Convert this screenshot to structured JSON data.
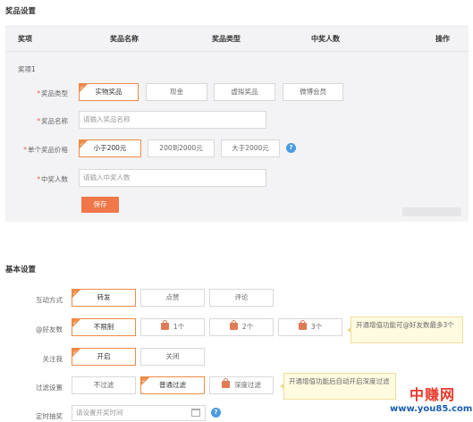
{
  "prize_settings": {
    "title": "奖品设置",
    "table_headers": [
      "奖项",
      "奖品名称",
      "奖品类型",
      "中奖人数",
      "操作"
    ],
    "prize_group_label": "奖项1",
    "prize_type": {
      "label": "奖品类型",
      "options": [
        "实物奖品",
        "现金",
        "虚拟奖品",
        "微博会员"
      ],
      "selected": "实物奖品"
    },
    "prize_name": {
      "label": "奖品名称",
      "placeholder": "请输入奖品名称"
    },
    "unit_price": {
      "label": "单个奖品价格",
      "options": [
        "小于200元",
        "200到2000元",
        "大于2000元"
      ],
      "selected": "小于200元",
      "help": "?"
    },
    "winner_count": {
      "label": "中奖人数",
      "placeholder": "请输入中奖人数"
    },
    "save_label": "保存"
  },
  "basic_settings": {
    "title": "基本设置",
    "interaction": {
      "label": "互动方式",
      "options": [
        "转发",
        "点赞",
        "评论"
      ],
      "selected": "转发"
    },
    "mention_friends": {
      "label": "@好友数",
      "options": [
        "不限制",
        "1个",
        "2个",
        "3个"
      ],
      "selected": "不限制",
      "tip": "开通增值功能可@好友数最多3个"
    },
    "follow_me": {
      "label": "关注我",
      "options": [
        "开启",
        "关闭"
      ],
      "selected": "开启"
    },
    "filter": {
      "label": "过滤设置",
      "options": [
        "不过滤",
        "普通过滤",
        "深度过滤"
      ],
      "selected": "普通过滤",
      "tip": "开通增值功能后自动开启深度过滤"
    },
    "scheduled_draw": {
      "label": "定时抽奖",
      "placeholder": "请设置开奖时间",
      "help": "?"
    }
  },
  "watermark": {
    "cn": "中赚网",
    "en": "www.you85.com"
  },
  "colors": {
    "accent": "#f0774a",
    "help": "#4a9be0",
    "panel": "#f3f3f5"
  }
}
